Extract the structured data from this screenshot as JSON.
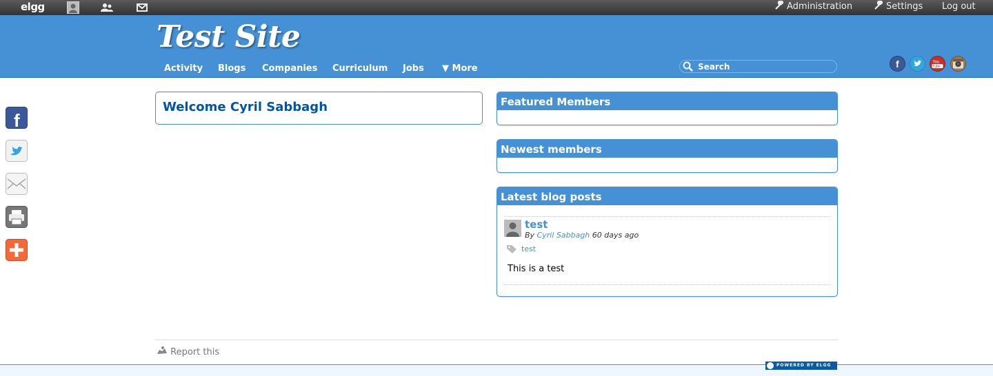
{
  "topbar": {
    "logo": "elgg",
    "admin_label": "Administration",
    "settings_label": "Settings",
    "logout_label": "Log out"
  },
  "header": {
    "site_title": "Test Site",
    "nav": [
      "Activity",
      "Blogs",
      "Companies",
      "Curriculum",
      "Jobs",
      "▼ More"
    ],
    "search_placeholder": "Search",
    "social_icons": [
      "facebook-icon",
      "twitter-icon",
      "youtube-icon",
      "instagram-icon"
    ]
  },
  "share_bar": [
    "facebook-icon",
    "twitter-icon",
    "email-icon",
    "print-icon",
    "add-icon"
  ],
  "main": {
    "welcome": "Welcome Cyril Sabbagh"
  },
  "sidebar": {
    "featured_title": "Featured Members",
    "newest_title": "Newest members",
    "blog_title": "Latest blog posts",
    "post": {
      "title": "test",
      "by": "By",
      "author": "Cyril Sabbagh",
      "age": "60 days ago",
      "tag": "test",
      "body": "This is a test"
    }
  },
  "footer": {
    "report": "Report this",
    "powered": "POWERED BY ELGG"
  },
  "colors": {
    "brand": "#4690d6",
    "topbar": "#333333",
    "heading": "#0054a7"
  }
}
